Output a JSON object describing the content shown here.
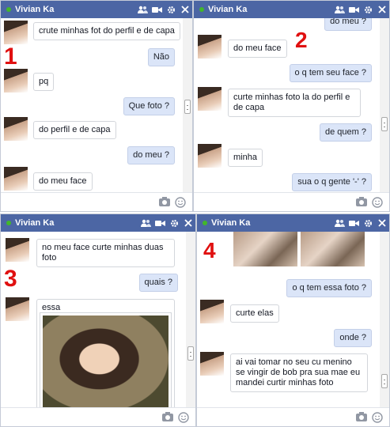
{
  "contact_name": "Vivian Ka",
  "colors": {
    "header": "#4c66a4",
    "online": "#42b72a",
    "my_bubble": "#dbe5f8",
    "number": "#e01010"
  },
  "icons": [
    "add-friend-icon",
    "video-call-icon",
    "gear-icon",
    "close-icon",
    "camera-icon",
    "emoji-icon",
    "scroll-thumb"
  ],
  "panels": [
    {
      "number": "1",
      "messages": [
        {
          "from": "them",
          "text": "crute minhas fot do perfil e de capa"
        },
        {
          "from": "me",
          "text": "Não"
        },
        {
          "from": "them",
          "text": "pq"
        },
        {
          "from": "me",
          "text": "Que foto ?"
        },
        {
          "from": "them",
          "text": "do perfil e de capa"
        },
        {
          "from": "me",
          "text": "do meu ?"
        },
        {
          "from": "them",
          "text": "do meu face"
        }
      ]
    },
    {
      "number": "2",
      "messages": [
        {
          "from": "me",
          "text": "do meu ?"
        },
        {
          "from": "them",
          "text": "do meu face"
        },
        {
          "from": "me",
          "text": "o q tem seu face ?"
        },
        {
          "from": "them",
          "text": "curte minhas foto la do perfil e de capa"
        },
        {
          "from": "me",
          "text": "de quem ?"
        },
        {
          "from": "them",
          "text": "minha"
        },
        {
          "from": "me",
          "text": "sua o q gente '-' ?"
        }
      ]
    },
    {
      "number": "3",
      "messages": [
        {
          "from": "them",
          "text": "no meu face curte minhas duas foto"
        },
        {
          "from": "me",
          "text": "quais ?"
        },
        {
          "from": "them",
          "text": "essa"
        }
      ]
    },
    {
      "number": "4",
      "messages": [
        {
          "from": "me",
          "text": "o q tem essa foto ?"
        },
        {
          "from": "them",
          "text": "curte elas"
        },
        {
          "from": "me",
          "text": "onde ?"
        },
        {
          "from": "them",
          "text": "ai vai tomar no seu cu menino se vingir de bob pra sua mae eu mandei curtir minhas foto"
        }
      ]
    }
  ]
}
